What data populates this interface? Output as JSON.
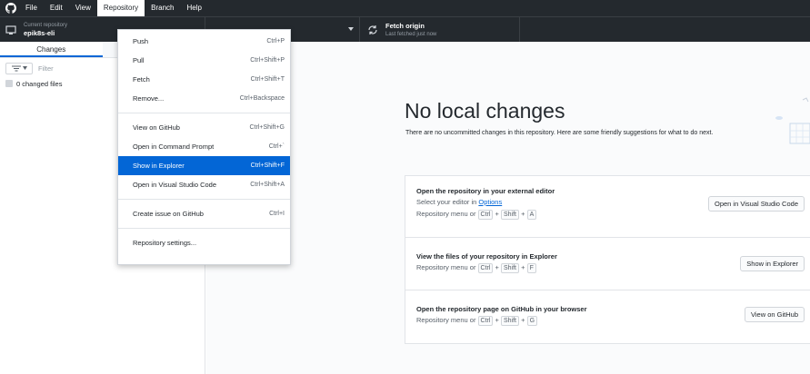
{
  "menubar": {
    "items": [
      {
        "label": "File"
      },
      {
        "label": "Edit"
      },
      {
        "label": "View"
      },
      {
        "label": "Repository"
      },
      {
        "label": "Branch"
      },
      {
        "label": "Help"
      }
    ]
  },
  "toolbar": {
    "repo_caption": "Current repository",
    "repo_name": "epik8s-eli",
    "fetch_title": "Fetch origin",
    "fetch_sub": "Last fetched just now"
  },
  "sidebar": {
    "tab_changes": "Changes",
    "filter_placeholder": "Filter",
    "changed_files": "0 changed files"
  },
  "main": {
    "title": "No local changes",
    "description": "There are no uncommitted changes in this repository. Here are some friendly suggestions for what to do next.",
    "suggestions": {
      "editor": {
        "title": "Open the repository in your external editor",
        "line1_prefix": "Select your editor in ",
        "line1_link": "Options",
        "line2_prefix": "Repository menu or ",
        "keys": [
          "Ctrl",
          "Shift",
          "A"
        ],
        "button": "Open in Visual Studio Code"
      },
      "explorer": {
        "title": "View the files of your repository in Explorer",
        "line_prefix": "Repository menu or ",
        "keys": [
          "Ctrl",
          "Shift",
          "F"
        ],
        "button": "Show in Explorer"
      },
      "github": {
        "title": "Open the repository page on GitHub in your browser",
        "line_prefix": "Repository menu or ",
        "keys": [
          "Ctrl",
          "Shift",
          "G"
        ],
        "button": "View on GitHub"
      }
    }
  },
  "dropdown": {
    "items": [
      {
        "label": "Push",
        "accel": "Ctrl+P"
      },
      {
        "label": "Pull",
        "accel": "Ctrl+Shift+P"
      },
      {
        "label": "Fetch",
        "accel": "Ctrl+Shift+T"
      },
      {
        "label": "Remove...",
        "accel": "Ctrl+Backspace"
      },
      {
        "label": "View on GitHub",
        "accel": "Ctrl+Shift+G"
      },
      {
        "label": "Open in Command Prompt",
        "accel": "Ctrl+`"
      },
      {
        "label": "Show in Explorer",
        "accel": "Ctrl+Shift+F"
      },
      {
        "label": "Open in Visual Studio Code",
        "accel": "Ctrl+Shift+A"
      },
      {
        "label": "Create issue on GitHub",
        "accel": "Ctrl+I"
      },
      {
        "label": "Repository settings...",
        "accel": ""
      }
    ]
  },
  "colors": {
    "chrome_bg": "#24292e",
    "accent": "#0366d6",
    "highlight_item": "#0366d6"
  }
}
